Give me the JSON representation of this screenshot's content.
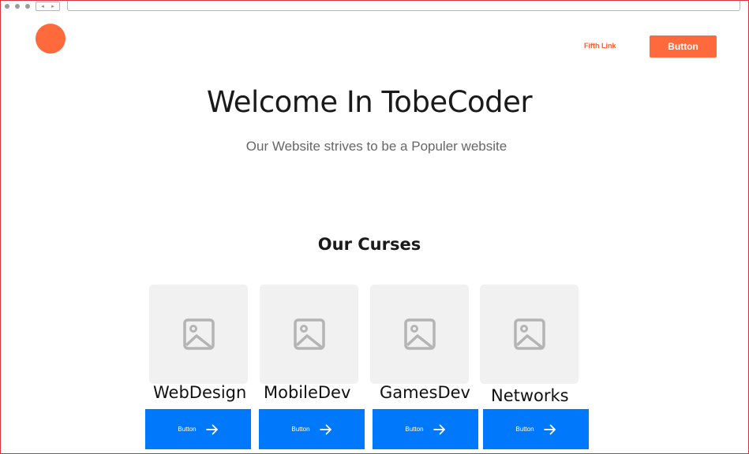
{
  "header": {
    "nav_link": "Fifth Link",
    "button_label": "Button"
  },
  "hero": {
    "title": "Welcome In TobeCoder",
    "subtitle": "Our Website strives  to be a Populer website"
  },
  "courses": {
    "title": "Our Curses",
    "items": [
      {
        "name": "WebDesign",
        "button_label": "Button",
        "icon": "image-placeholder-icon"
      },
      {
        "name": "MobileDev",
        "button_label": "Button",
        "icon": "image-placeholder-icon"
      },
      {
        "name": "GamesDev",
        "button_label": "Button",
        "icon": "image-placeholder-icon"
      },
      {
        "name": "Networks",
        "button_label": "Button",
        "icon": "image-placeholder-icon"
      }
    ]
  },
  "colors": {
    "accent": "#ff6a3d",
    "primary_button": "#0078fb"
  }
}
